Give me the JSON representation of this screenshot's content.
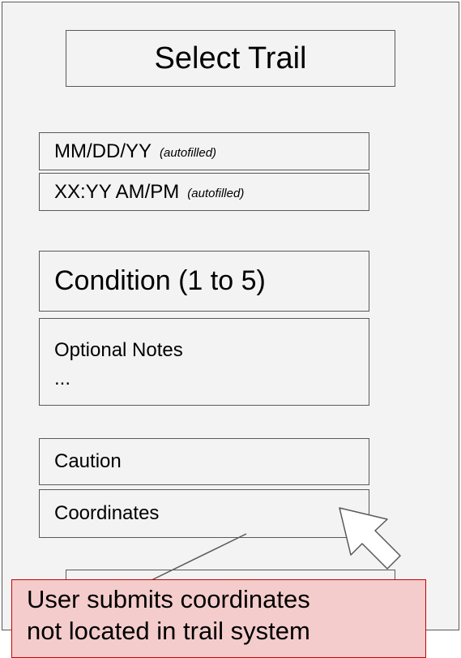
{
  "colors": {
    "panel_background": "#f3f3f3",
    "border": "#595959",
    "callout_background": "#f4cccc",
    "callout_border": "#cc0000"
  },
  "form": {
    "select_trail_label": "Select Trail",
    "date": {
      "value": "MM/DD/YY",
      "hint": "(autofilled)"
    },
    "time": {
      "value": "XX:YY AM/PM",
      "hint": "(autofilled)"
    },
    "condition_label": "Condition (1 to 5)",
    "notes": {
      "label": "Optional Notes",
      "ellipsis": "..."
    },
    "caution_label": "Caution",
    "coordinates_label": "Coordinates"
  },
  "annotation": {
    "line1": "User submits coordinates",
    "line2": "not located in trail system"
  },
  "icons": {
    "pointer": "cursor-arrow-icon"
  }
}
